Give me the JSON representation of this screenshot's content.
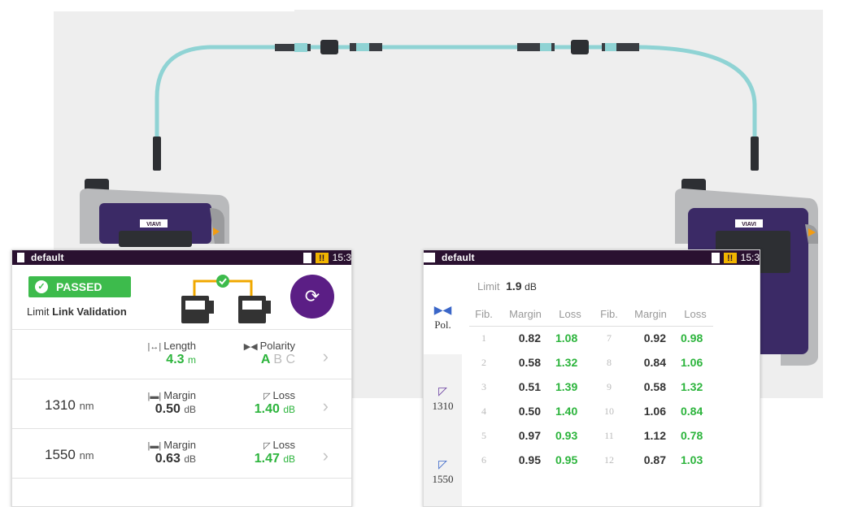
{
  "devices": {
    "brand": "VIAVI"
  },
  "left_panel": {
    "status_bar": {
      "title": "default",
      "clock": "15:3"
    },
    "result_badge": "PASSED",
    "subtitle_prefix": "Limit",
    "subtitle_bold": "Link Validation",
    "summary": {
      "length_label": "Length",
      "length_value": "4.3",
      "length_unit": "m",
      "polarity_label": "Polarity",
      "polarity_active": "A",
      "polarity_rest": "B C"
    },
    "wavelengths": [
      {
        "wl": "1310",
        "unit": "nm",
        "margin_label": "Margin",
        "margin": "0.50",
        "margin_unit": "dB",
        "loss_label": "Loss",
        "loss": "1.40",
        "loss_unit": "dB"
      },
      {
        "wl": "1550",
        "unit": "nm",
        "margin_label": "Margin",
        "margin": "0.63",
        "margin_unit": "dB",
        "loss_label": "Loss",
        "loss": "1.47",
        "loss_unit": "dB"
      }
    ]
  },
  "right_panel": {
    "status_bar": {
      "title": "default",
      "clock": "15:3"
    },
    "tabs": [
      {
        "label": "Pol."
      },
      {
        "label": "1310"
      },
      {
        "label": "1550"
      }
    ],
    "limit_label": "Limit",
    "limit_value": "1.9",
    "limit_unit": "dB",
    "headers": {
      "fib": "Fib.",
      "margin": "Margin",
      "loss": "Loss"
    },
    "rows": [
      [
        {
          "fib": "1",
          "margin": "0.82",
          "loss": "1.08"
        },
        {
          "fib": "7",
          "margin": "0.92",
          "loss": "0.98"
        }
      ],
      [
        {
          "fib": "2",
          "margin": "0.58",
          "loss": "1.32"
        },
        {
          "fib": "8",
          "margin": "0.84",
          "loss": "1.06"
        }
      ],
      [
        {
          "fib": "3",
          "margin": "0.51",
          "loss": "1.39"
        },
        {
          "fib": "9",
          "margin": "0.58",
          "loss": "1.32"
        }
      ],
      [
        {
          "fib": "4",
          "margin": "0.50",
          "loss": "1.40"
        },
        {
          "fib": "10",
          "margin": "1.06",
          "loss": "0.84"
        }
      ],
      [
        {
          "fib": "5",
          "margin": "0.97",
          "loss": "0.93"
        },
        {
          "fib": "11",
          "margin": "1.12",
          "loss": "0.78"
        }
      ],
      [
        {
          "fib": "6",
          "margin": "0.95",
          "loss": "0.95"
        },
        {
          "fib": "12",
          "margin": "0.87",
          "loss": "1.03"
        }
      ]
    ]
  },
  "colors": {
    "passed": "#3dbb4c",
    "loss_green": "#2cb43c",
    "status_bar": "#2a1130",
    "sync_button": "#5b1e85",
    "cable": "#8fd3d4",
    "warning": "#f1b400"
  }
}
